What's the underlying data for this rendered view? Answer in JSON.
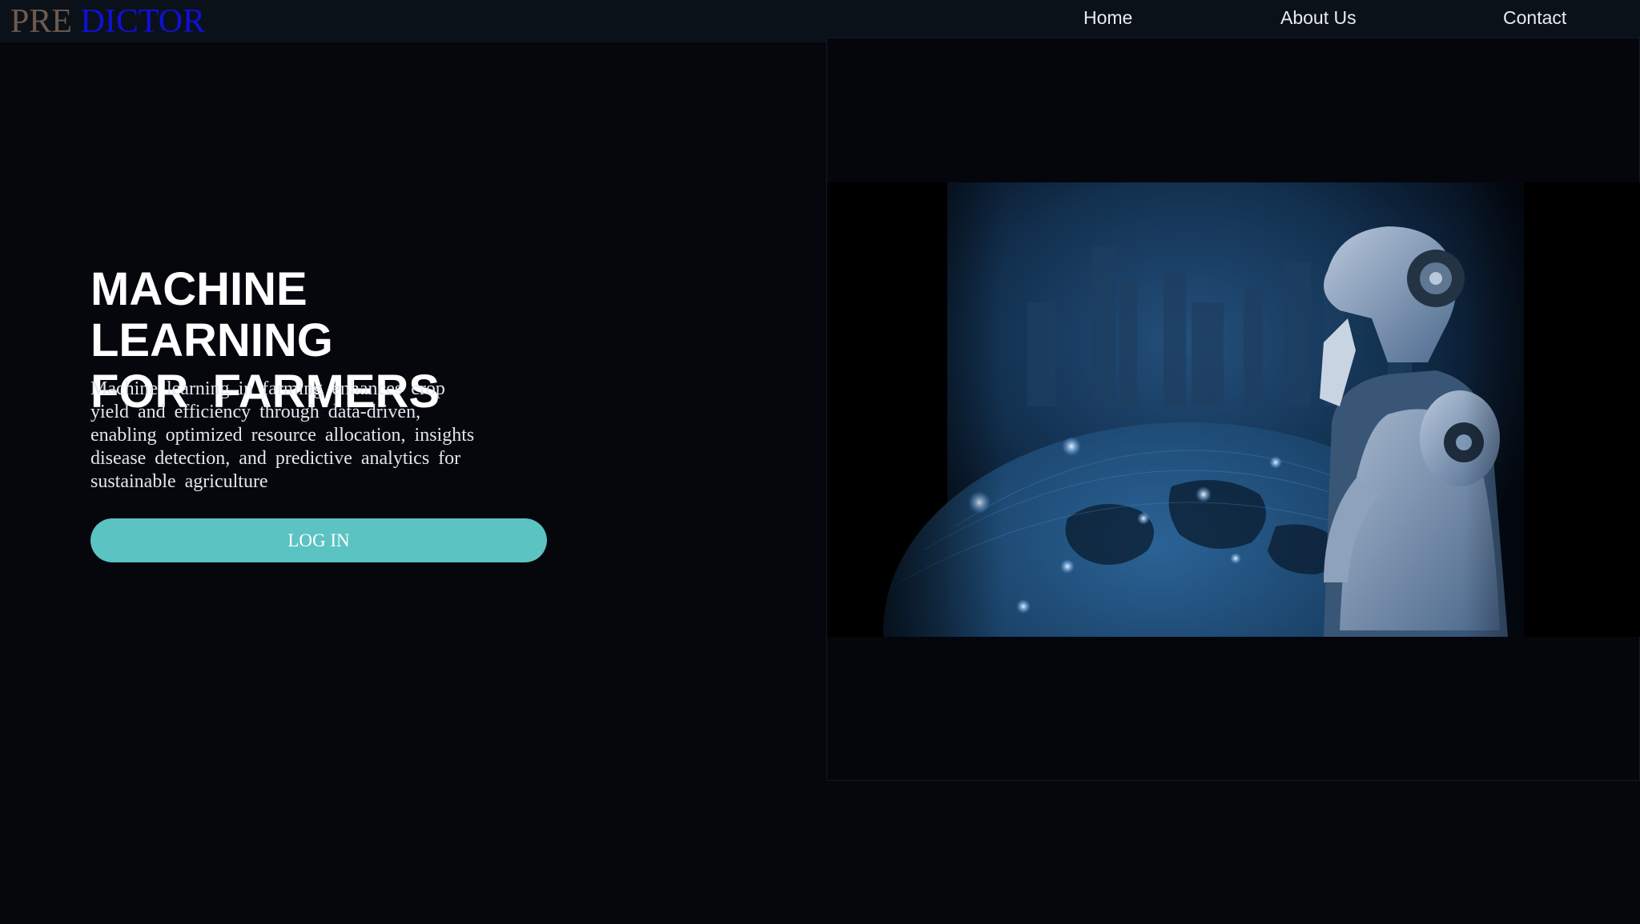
{
  "brand": {
    "part1": "PRE",
    "part2": "DICTOR"
  },
  "nav": {
    "home": "Home",
    "about": "About Us",
    "contact": "Contact"
  },
  "hero": {
    "title_line1": "MACHINE LEARNING",
    "title_line2": "FOR FARMERS",
    "description": "Machine learning in farming enhances crop yield and efficiency through data-driven, enabling optimized resource allocation, insights disease detection, and predictive analytics for sustainable agriculture",
    "login_label": "LOG IN"
  },
  "colors": {
    "background": "#05070d",
    "nav_background": "#0b1119",
    "brand_pre": "#6e5a4c",
    "brand_dictor": "#1010d8",
    "button": "#5bc3c2"
  }
}
